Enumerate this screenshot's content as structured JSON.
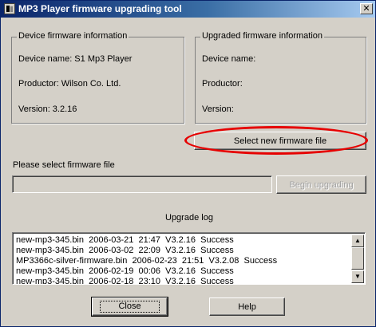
{
  "window": {
    "title": "MP3 Player firmware upgrading tool",
    "close_glyph": "✕",
    "app_icon": "equalizer-icon"
  },
  "device_info": {
    "legend": "Device firmware information",
    "name_label": "Device name: S1 Mp3 Player",
    "productor_label": "Productor: Wilson Co. Ltd.",
    "version_label": "Version: 3.2.16"
  },
  "upgraded_info": {
    "legend": "Upgraded firmware information",
    "name_label": "Device name:",
    "productor_label": "Productor:",
    "version_label": "Version:"
  },
  "select_button": {
    "label": "Select new firmware file",
    "highlight_color": "#e60000"
  },
  "firmware_file": {
    "label": "Please select firmware file",
    "value": "",
    "begin_button": "Begin upgrading",
    "begin_enabled": false
  },
  "log": {
    "title": "Upgrade log",
    "rows": [
      "new-mp3-345.bin  2006-03-21  21:47  V3.2.16  Success",
      "new-mp3-345.bin  2006-03-02  22:09  V3.2.16  Success",
      "MP3366c-silver-firmware.bin  2006-02-23  21:51  V3.2.08  Success",
      "new-mp3-345.bin  2006-02-19  00:06  V3.2.16  Success",
      "new-mp3-345.bin  2006-02-18  23:10  V3.2.16  Success"
    ],
    "scroll_up_glyph": "▲",
    "scroll_down_glyph": "▼"
  },
  "footer": {
    "close_button": "Close",
    "help_button": "Help"
  },
  "colors": {
    "titlebar_start": "#0a246a",
    "titlebar_end": "#a6caf0",
    "face": "#d4d0c8"
  }
}
